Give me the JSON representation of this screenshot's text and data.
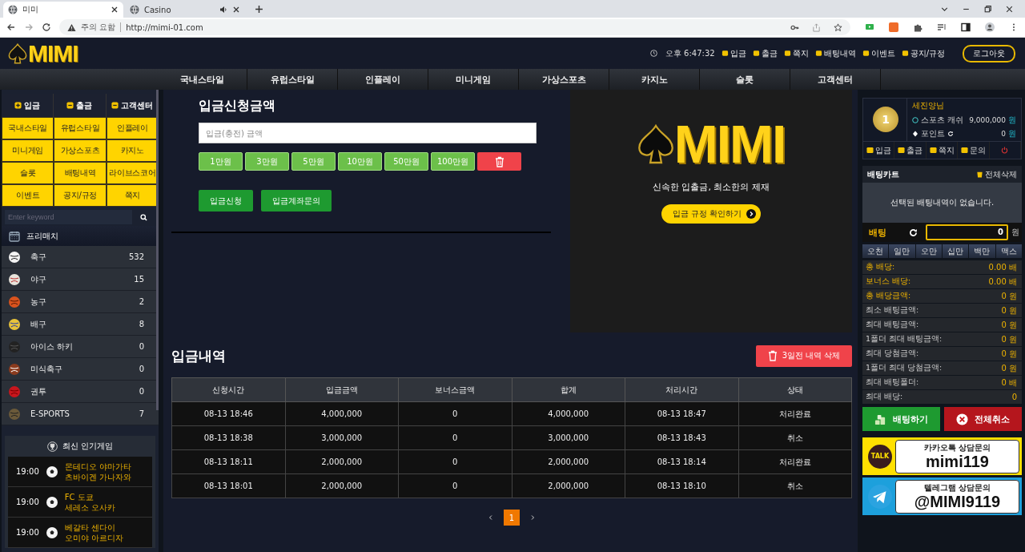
{
  "browser": {
    "tabs": [
      {
        "title": "미미",
        "selected": true,
        "audio": false
      },
      {
        "title": "Casino",
        "selected": false,
        "audio": true
      }
    ],
    "security": "주의 요함",
    "url": "http://mimi-01.com"
  },
  "header": {
    "logo": "MIMI",
    "clock": "오후 6:47:32",
    "links": [
      "입금",
      "출금",
      "쪽지",
      "배팅내역",
      "이벤트",
      "공지/규정"
    ],
    "logout": "로그아웃"
  },
  "nav": [
    "국내스타일",
    "유럽스타일",
    "인플레이",
    "미니게임",
    "가상스포츠",
    "카지노",
    "슬롯",
    "고객센터"
  ],
  "sidebar": {
    "top_buttons": [
      "입금",
      "출금",
      "고객센터"
    ],
    "menu": [
      "국내스타일",
      "유럽스타일",
      "인플레이",
      "미니게임",
      "가상스포츠",
      "카지노",
      "슬롯",
      "배팅내역",
      "라이브스코어",
      "이벤트",
      "공지/규정",
      "쪽지"
    ],
    "search": {
      "placeholder": "Enter keyword"
    },
    "section": "프리매치",
    "sports": [
      {
        "name": "축구",
        "count": "532"
      },
      {
        "name": "야구",
        "count": "15"
      },
      {
        "name": "농구",
        "count": "2"
      },
      {
        "name": "배구",
        "count": "8"
      },
      {
        "name": "아이스 하키",
        "count": "0"
      },
      {
        "name": "미식축구",
        "count": "0"
      },
      {
        "name": "권투",
        "count": "0"
      },
      {
        "name": "E-SPORTS",
        "count": "7"
      }
    ],
    "popular": {
      "title": "최신 인기게임",
      "games": [
        {
          "time": "19:00",
          "home": "몬테디오 야마가타",
          "away": "츠바이겐 가나자와"
        },
        {
          "time": "19:00",
          "home": "FC 도쿄",
          "away": "세레소 오사카"
        },
        {
          "time": "19:00",
          "home": "베갈타 센다이",
          "away": "오미야 아르디자"
        }
      ]
    }
  },
  "deposit": {
    "title": "입금신청금액",
    "placeholder": "입금(충전) 금액",
    "amounts": [
      "1만원",
      "3만원",
      "5만원",
      "10만원",
      "50만원",
      "100만원"
    ],
    "actions": [
      "입금신청",
      "입금계좌문의"
    ]
  },
  "promo": {
    "logo": "MIMI",
    "tagline": "신속한 입출금, 최소한의 제재",
    "button": "입금 규정 확인하기"
  },
  "history": {
    "title": "입금내역",
    "delete_button": "3일전 내역 삭제",
    "table": {
      "columns": [
        "신청시간",
        "입금금액",
        "보너스금액",
        "합계",
        "처리시간",
        "상태"
      ],
      "rows": [
        [
          "08-13 18:46",
          "4,000,000",
          "0",
          "4,000,000",
          "08-13 18:47",
          "처리완료"
        ],
        [
          "08-13 18:38",
          "3,000,000",
          "0",
          "3,000,000",
          "08-13 18:43",
          "취소"
        ],
        [
          "08-13 18:11",
          "2,000,000",
          "0",
          "2,000,000",
          "08-13 18:14",
          "처리완료"
        ],
        [
          "08-13 18:01",
          "2,000,000",
          "0",
          "2,000,000",
          "08-13 18:10",
          "취소"
        ]
      ]
    },
    "pages": [
      {
        "label": "1",
        "selected": true
      }
    ]
  },
  "account": {
    "badge": "1",
    "name": "세진양님",
    "balances": [
      {
        "label": "스포츠 캐쉬",
        "value": "9,000,000",
        "unit": "원"
      },
      {
        "label": "포인트",
        "value": "0",
        "unit": "원"
      }
    ],
    "actions": [
      "입금",
      "출금",
      "쪽지",
      "문의"
    ]
  },
  "cart": {
    "title": "배팅카트",
    "clear": "전체삭제",
    "empty": "선택된 배팅내역이 없습니다.",
    "bet_label": "배팅",
    "amount": "0",
    "unit": "원",
    "chips": [
      "오천",
      "일만",
      "오만",
      "십만",
      "백만",
      "맥스"
    ],
    "summary": [
      {
        "label": "총 배당:",
        "value": "0.00 배",
        "highlight": true
      },
      {
        "label": "보너스 배당:",
        "value": "0.00 배",
        "highlight": true
      },
      {
        "label": "총 배당금액:",
        "value": "0 원",
        "highlight": true
      },
      {
        "label": "최소 배팅금액:",
        "value": "0 원",
        "highlight": false
      },
      {
        "label": "최대 배팅금액:",
        "value": "0 원",
        "highlight": false
      },
      {
        "label": "1폴더 최대 배팅금액:",
        "value": "0 원",
        "highlight": false
      },
      {
        "label": "최대 당첨금액:",
        "value": "0 원",
        "highlight": false
      },
      {
        "label": "1폴더 최대 당첨금액:",
        "value": "0 원",
        "highlight": false
      },
      {
        "label": "최대 배팅폴더:",
        "value": "0 배",
        "highlight": false
      },
      {
        "label": "최대 배당:",
        "value": "0",
        "highlight": false
      }
    ],
    "bet_button": "배팅하기",
    "cancel_button": "전체취소"
  },
  "contacts": [
    {
      "kind": "kakao",
      "badge": "TALK",
      "title": "카카오톡 상담문의",
      "id": "mimi119"
    },
    {
      "kind": "telegram",
      "title": "텔레그램 상담문의",
      "id": "@MIMI9119"
    }
  ]
}
